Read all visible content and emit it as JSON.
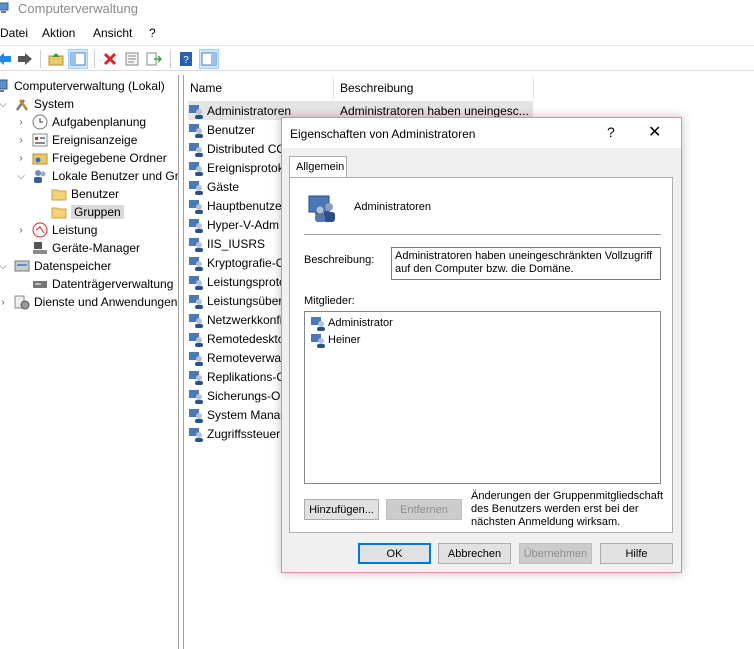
{
  "window": {
    "title": "Computerverwaltung"
  },
  "menu": {
    "items": [
      "Datei",
      "Aktion",
      "Ansicht",
      "?"
    ]
  },
  "tree": {
    "root": "Computerverwaltung (Lokal)",
    "system": "System",
    "aufgabenplanung": "Aufgabenplanung",
    "ereignisanzeige": "Ereignisanzeige",
    "freigegebene_ordner": "Freigegebene Ordner",
    "lokale_benutzer": "Lokale Benutzer und Gr",
    "benutzer": "Benutzer",
    "gruppen": "Gruppen",
    "leistung": "Leistung",
    "geraete_manager": "Geräte-Manager",
    "datenspeicher": "Datenspeicher",
    "datentraegerverwaltung": "Datenträgerverwaltung",
    "dienste": "Dienste und Anwendungen"
  },
  "list": {
    "columns": {
      "name": "Name",
      "description": "Beschreibung"
    },
    "rows": [
      {
        "name": "Administratoren",
        "description": "Administratoren haben uneingesc..."
      },
      {
        "name": "Benutzer",
        "description": ""
      },
      {
        "name": "Distributed CO",
        "description": ""
      },
      {
        "name": "Ereignisprotok",
        "description": ""
      },
      {
        "name": "Gäste",
        "description": ""
      },
      {
        "name": "Hauptbenutze",
        "description": ""
      },
      {
        "name": "Hyper-V-Adm",
        "description": ""
      },
      {
        "name": "IIS_IUSRS",
        "description": ""
      },
      {
        "name": "Kryptografie-O",
        "description": ""
      },
      {
        "name": "Leistungsproto",
        "description": ""
      },
      {
        "name": "Leistungsüber",
        "description": ""
      },
      {
        "name": "Netzwerkkonfi",
        "description": ""
      },
      {
        "name": "Remotedesktop",
        "description": ""
      },
      {
        "name": "Remoteverwalt",
        "description": ""
      },
      {
        "name": "Replikations-O",
        "description": ""
      },
      {
        "name": "Sicherungs-Op",
        "description": ""
      },
      {
        "name": "System Manag",
        "description": ""
      },
      {
        "name": "Zugriffssteuer",
        "description": ""
      }
    ]
  },
  "dialog": {
    "title": "Eigenschaften von Administratoren",
    "help": "?",
    "close": "✕",
    "tab": "Allgemein",
    "group_name": "Administratoren",
    "description_label": "Beschreibung:",
    "description_value": "Administratoren haben uneingeschränkten Vollzugriff auf den Computer bzw. die Domäne.",
    "members_label": "Mitglieder:",
    "members": [
      "Administrator",
      "Heiner"
    ],
    "add_button": "Hinzufügen...",
    "remove_button": "Entfernen",
    "note": "Änderungen der Gruppenmitgliedschaft des Benutzers werden erst bei der nächsten Anmeldung wirksam.",
    "ok_button": "OK",
    "cancel_button": "Abbrechen",
    "apply_button": "Übernehmen",
    "help_button": "Hilfe"
  },
  "colors": {
    "accent": "#0078d7",
    "dialog_border": "#d98fa9",
    "selection": "#d9d9d9"
  }
}
